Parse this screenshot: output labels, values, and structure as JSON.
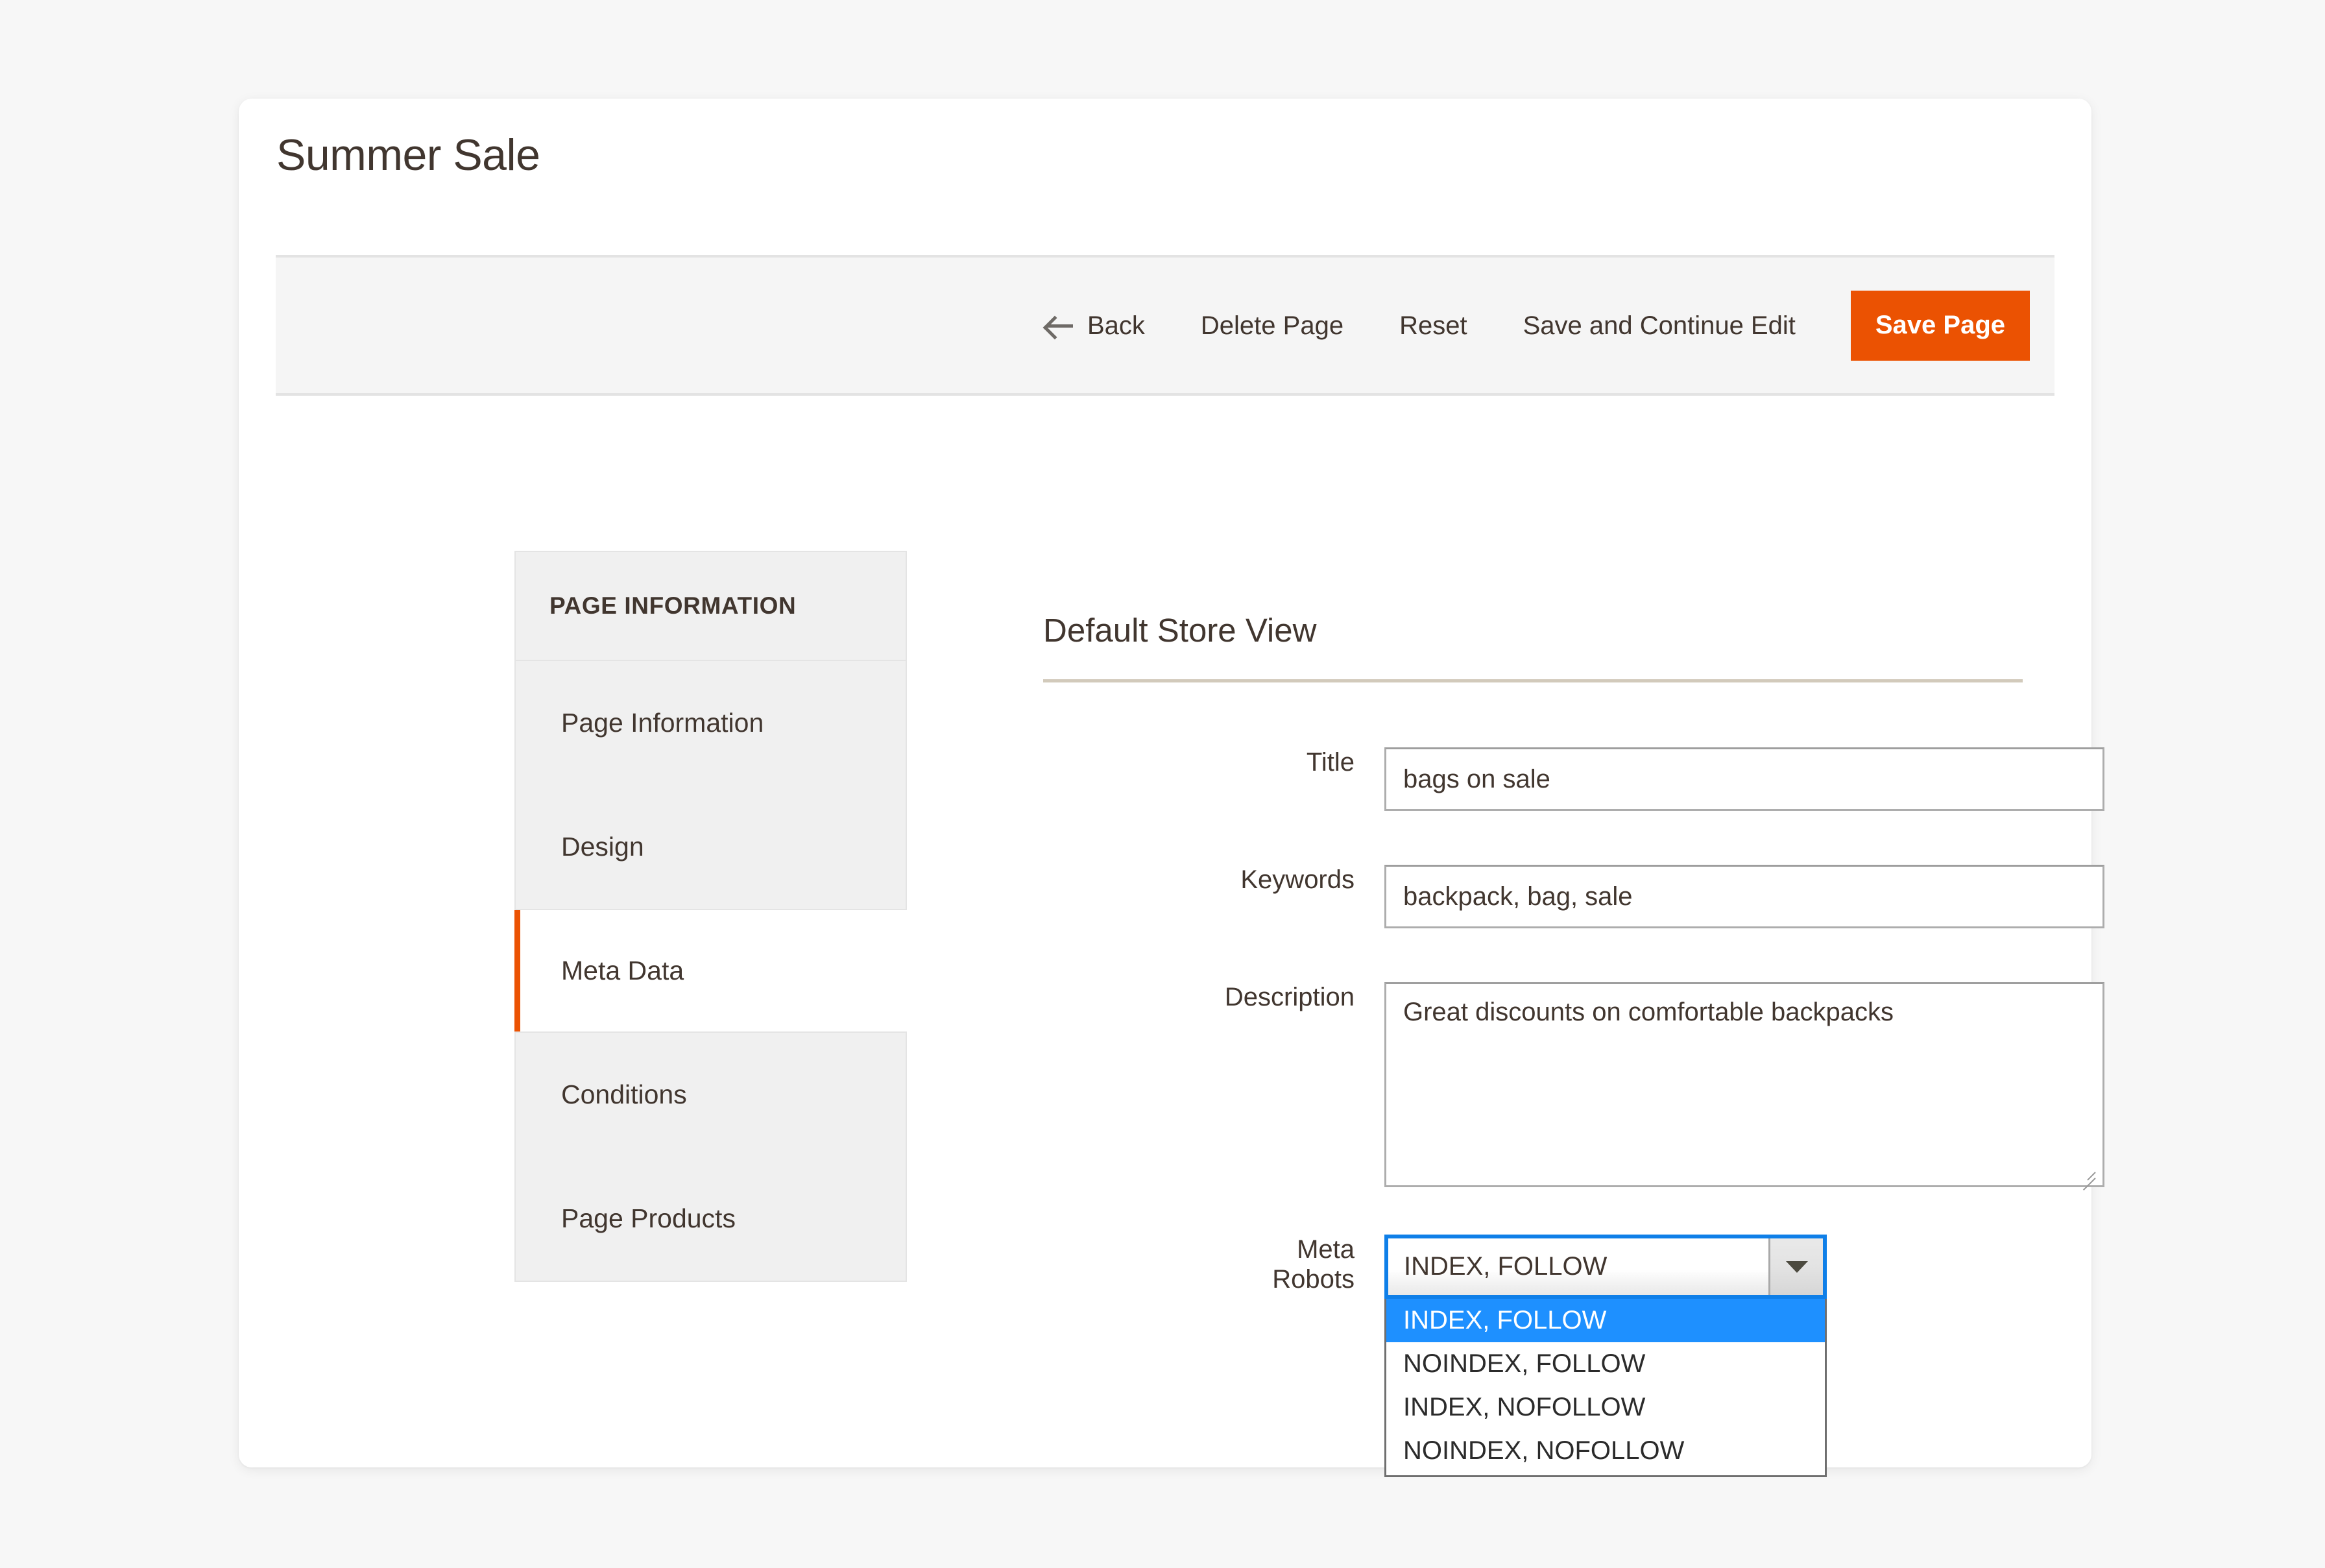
{
  "page": {
    "title": "Summer Sale"
  },
  "toolbar": {
    "back_icon": "arrow-left-icon",
    "back_label": "Back",
    "delete_page_label": "Delete Page",
    "reset_label": "Reset",
    "save_and_continue_label": "Save and Continue Edit",
    "save_page_label": "Save Page",
    "primary_color": "#eb5202"
  },
  "sidebar": {
    "title": "PAGE INFORMATION",
    "active_accent_color": "#eb5202",
    "items": [
      {
        "label": "Page Information",
        "active": false
      },
      {
        "label": "Design",
        "active": false
      },
      {
        "label": "Meta Data",
        "active": true
      },
      {
        "label": "Conditions",
        "active": false
      },
      {
        "label": "Page Products",
        "active": false
      }
    ]
  },
  "main": {
    "section_heading": "Default Store View",
    "fields": {
      "title": {
        "label": "Title",
        "value": "bags on sale",
        "placeholder": ""
      },
      "keywords": {
        "label": "Keywords",
        "value": "backpack, bag, sale",
        "placeholder": ""
      },
      "description": {
        "label": "Description",
        "value": "Great discounts on comfortable backpacks",
        "placeholder": ""
      },
      "meta_robots": {
        "label_line1": "Meta",
        "label_line2": "Robots",
        "selected_value": "INDEX, FOLLOW",
        "expanded": true,
        "highlight_color": "#1e90ff",
        "options": [
          {
            "label": "INDEX, FOLLOW",
            "selected": true
          },
          {
            "label": "NOINDEX, FOLLOW",
            "selected": false
          },
          {
            "label": "INDEX, NOFOLLOW",
            "selected": false
          },
          {
            "label": "NOINDEX, NOFOLLOW",
            "selected": false
          }
        ]
      }
    }
  }
}
